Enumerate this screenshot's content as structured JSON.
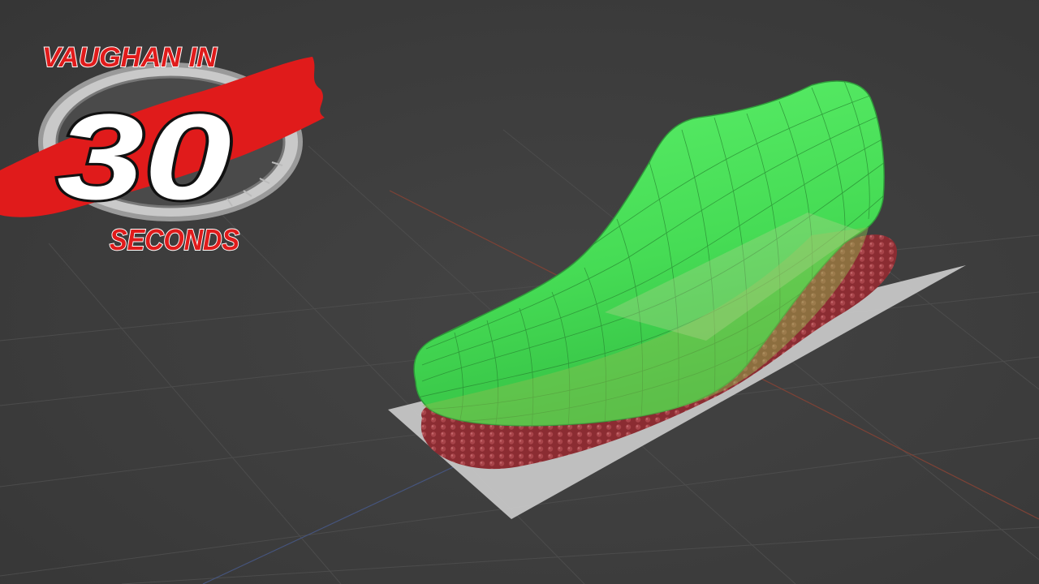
{
  "logo": {
    "line1": "VAUGHAN IN",
    "number": "30",
    "line2": "SECONDS"
  },
  "colors": {
    "viewport_bg": "#3d3d3d",
    "grid": "#4a4a4a",
    "axis_x": "#8a4a3e",
    "axis_y": "#4a5a8a",
    "last_green": "#4ee15c",
    "last_wire": "#2b8a35",
    "insole_red": "#8a2b30",
    "plane_gray": "#c9c9c9",
    "brand_red": "#e01b1b"
  },
  "icons": [
    "stopwatch-icon"
  ]
}
